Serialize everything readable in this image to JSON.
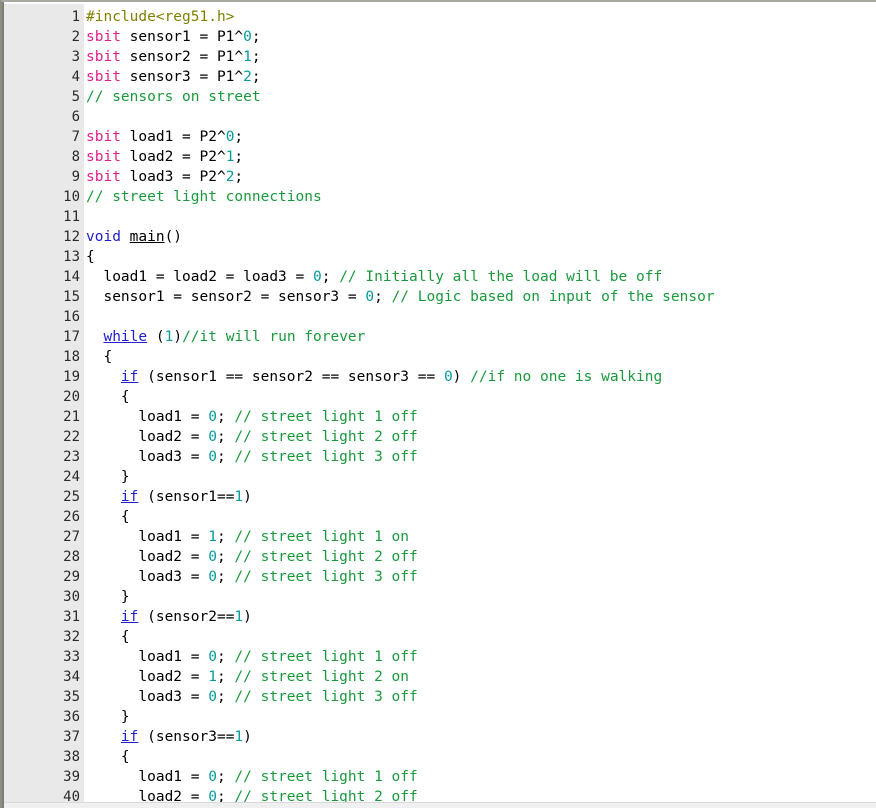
{
  "editor": {
    "name": "code-viewer",
    "language": "C (8051 / Keil)",
    "theme": {
      "background": "#ffffff",
      "gutter_background": "#e9e9e9",
      "gutter_text": "#2b2b2b",
      "plain_text": "#000000",
      "preprocessor": "#808000",
      "type_keyword": "#e0218a",
      "keyword": "#2020d0",
      "number": "#069a9a",
      "comment": "#199a3c",
      "border": "#8d8d84"
    },
    "first_line": 1,
    "last_line": 40,
    "total_visible_lines": 40
  },
  "code": {
    "lines": [
      {
        "n": "1",
        "tokens": [
          {
            "t": "preproc",
            "s": "#include<reg51.h>"
          }
        ]
      },
      {
        "n": "2",
        "tokens": [
          {
            "t": "type",
            "s": "sbit"
          },
          {
            "t": "plain",
            "s": " sensor1 = P1^"
          },
          {
            "t": "number",
            "s": "0"
          },
          {
            "t": "plain",
            "s": ";"
          }
        ]
      },
      {
        "n": "3",
        "tokens": [
          {
            "t": "type",
            "s": "sbit"
          },
          {
            "t": "plain",
            "s": " sensor2 = P1^"
          },
          {
            "t": "number",
            "s": "1"
          },
          {
            "t": "plain",
            "s": ";"
          }
        ]
      },
      {
        "n": "4",
        "tokens": [
          {
            "t": "type",
            "s": "sbit"
          },
          {
            "t": "plain",
            "s": " sensor3 = P1^"
          },
          {
            "t": "number",
            "s": "2"
          },
          {
            "t": "plain",
            "s": ";"
          }
        ]
      },
      {
        "n": "5",
        "tokens": [
          {
            "t": "comment",
            "s": "// sensors on street"
          }
        ]
      },
      {
        "n": "6",
        "tokens": [
          {
            "t": "plain",
            "s": ""
          }
        ]
      },
      {
        "n": "7",
        "tokens": [
          {
            "t": "type",
            "s": "sbit"
          },
          {
            "t": "plain",
            "s": " load1 = P2^"
          },
          {
            "t": "number",
            "s": "0"
          },
          {
            "t": "plain",
            "s": ";"
          }
        ]
      },
      {
        "n": "8",
        "tokens": [
          {
            "t": "type",
            "s": "sbit"
          },
          {
            "t": "plain",
            "s": " load2 = P2^"
          },
          {
            "t": "number",
            "s": "1"
          },
          {
            "t": "plain",
            "s": ";"
          }
        ]
      },
      {
        "n": "9",
        "tokens": [
          {
            "t": "type",
            "s": "sbit"
          },
          {
            "t": "plain",
            "s": " load3 = P2^"
          },
          {
            "t": "number",
            "s": "2"
          },
          {
            "t": "plain",
            "s": ";"
          }
        ]
      },
      {
        "n": "10",
        "tokens": [
          {
            "t": "comment",
            "s": "// street light connections"
          }
        ]
      },
      {
        "n": "11",
        "tokens": [
          {
            "t": "plain",
            "s": ""
          }
        ]
      },
      {
        "n": "12",
        "tokens": [
          {
            "t": "keyword-nu",
            "s": "void"
          },
          {
            "t": "plain",
            "s": " "
          },
          {
            "t": "ident-u",
            "s": "main"
          },
          {
            "t": "plain",
            "s": "()"
          }
        ]
      },
      {
        "n": "13",
        "tokens": [
          {
            "t": "plain",
            "s": "{"
          }
        ]
      },
      {
        "n": "14",
        "tokens": [
          {
            "t": "plain",
            "s": "  load1 = load2 = load3 = "
          },
          {
            "t": "number",
            "s": "0"
          },
          {
            "t": "plain",
            "s": "; "
          },
          {
            "t": "comment",
            "s": "// Initially all the load will be off"
          }
        ]
      },
      {
        "n": "15",
        "tokens": [
          {
            "t": "plain",
            "s": "  sensor1 = sensor2 = sensor3 = "
          },
          {
            "t": "number",
            "s": "0"
          },
          {
            "t": "plain",
            "s": "; "
          },
          {
            "t": "comment",
            "s": "// Logic based on input of the sensor"
          }
        ]
      },
      {
        "n": "16",
        "tokens": [
          {
            "t": "plain",
            "s": ""
          }
        ]
      },
      {
        "n": "17",
        "tokens": [
          {
            "t": "plain",
            "s": "  "
          },
          {
            "t": "keyword",
            "s": "while"
          },
          {
            "t": "plain",
            "s": " ("
          },
          {
            "t": "number",
            "s": "1"
          },
          {
            "t": "plain",
            "s": ")"
          },
          {
            "t": "comment",
            "s": "//it will run forever"
          }
        ]
      },
      {
        "n": "18",
        "tokens": [
          {
            "t": "plain",
            "s": "  {"
          }
        ]
      },
      {
        "n": "19",
        "tokens": [
          {
            "t": "plain",
            "s": "    "
          },
          {
            "t": "keyword",
            "s": "if"
          },
          {
            "t": "plain",
            "s": " (sensor1 == sensor2 == sensor3 == "
          },
          {
            "t": "number",
            "s": "0"
          },
          {
            "t": "plain",
            "s": ") "
          },
          {
            "t": "comment",
            "s": "//if no one is walking"
          }
        ]
      },
      {
        "n": "20",
        "tokens": [
          {
            "t": "plain",
            "s": "    {"
          }
        ]
      },
      {
        "n": "21",
        "tokens": [
          {
            "t": "plain",
            "s": "      load1 = "
          },
          {
            "t": "number",
            "s": "0"
          },
          {
            "t": "plain",
            "s": "; "
          },
          {
            "t": "comment",
            "s": "// street light 1 off"
          }
        ]
      },
      {
        "n": "22",
        "tokens": [
          {
            "t": "plain",
            "s": "      load2 = "
          },
          {
            "t": "number",
            "s": "0"
          },
          {
            "t": "plain",
            "s": "; "
          },
          {
            "t": "comment",
            "s": "// street light 2 off"
          }
        ]
      },
      {
        "n": "23",
        "tokens": [
          {
            "t": "plain",
            "s": "      load3 = "
          },
          {
            "t": "number",
            "s": "0"
          },
          {
            "t": "plain",
            "s": "; "
          },
          {
            "t": "comment",
            "s": "// street light 3 off"
          }
        ]
      },
      {
        "n": "24",
        "tokens": [
          {
            "t": "plain",
            "s": "    }"
          }
        ]
      },
      {
        "n": "25",
        "tokens": [
          {
            "t": "plain",
            "s": "    "
          },
          {
            "t": "keyword",
            "s": "if"
          },
          {
            "t": "plain",
            "s": " (sensor1=="
          },
          {
            "t": "number",
            "s": "1"
          },
          {
            "t": "plain",
            "s": ")"
          }
        ]
      },
      {
        "n": "26",
        "tokens": [
          {
            "t": "plain",
            "s": "    {"
          }
        ]
      },
      {
        "n": "27",
        "tokens": [
          {
            "t": "plain",
            "s": "      load1 = "
          },
          {
            "t": "number",
            "s": "1"
          },
          {
            "t": "plain",
            "s": "; "
          },
          {
            "t": "comment",
            "s": "// street light 1 on"
          }
        ]
      },
      {
        "n": "28",
        "tokens": [
          {
            "t": "plain",
            "s": "      load2 = "
          },
          {
            "t": "number",
            "s": "0"
          },
          {
            "t": "plain",
            "s": "; "
          },
          {
            "t": "comment",
            "s": "// street light 2 off"
          }
        ]
      },
      {
        "n": "29",
        "tokens": [
          {
            "t": "plain",
            "s": "      load3 = "
          },
          {
            "t": "number",
            "s": "0"
          },
          {
            "t": "plain",
            "s": "; "
          },
          {
            "t": "comment",
            "s": "// street light 3 off"
          }
        ]
      },
      {
        "n": "30",
        "tokens": [
          {
            "t": "plain",
            "s": "    }"
          }
        ]
      },
      {
        "n": "31",
        "tokens": [
          {
            "t": "plain",
            "s": "    "
          },
          {
            "t": "keyword",
            "s": "if"
          },
          {
            "t": "plain",
            "s": " (sensor2=="
          },
          {
            "t": "number",
            "s": "1"
          },
          {
            "t": "plain",
            "s": ")"
          }
        ]
      },
      {
        "n": "32",
        "tokens": [
          {
            "t": "plain",
            "s": "    {"
          }
        ]
      },
      {
        "n": "33",
        "tokens": [
          {
            "t": "plain",
            "s": "      load1 = "
          },
          {
            "t": "number",
            "s": "0"
          },
          {
            "t": "plain",
            "s": "; "
          },
          {
            "t": "comment",
            "s": "// street light 1 off"
          }
        ]
      },
      {
        "n": "34",
        "tokens": [
          {
            "t": "plain",
            "s": "      load2 = "
          },
          {
            "t": "number",
            "s": "1"
          },
          {
            "t": "plain",
            "s": "; "
          },
          {
            "t": "comment",
            "s": "// street light 2 on"
          }
        ]
      },
      {
        "n": "35",
        "tokens": [
          {
            "t": "plain",
            "s": "      load3 = "
          },
          {
            "t": "number",
            "s": "0"
          },
          {
            "t": "plain",
            "s": "; "
          },
          {
            "t": "comment",
            "s": "// street light 3 off"
          }
        ]
      },
      {
        "n": "36",
        "tokens": [
          {
            "t": "plain",
            "s": "    }"
          }
        ]
      },
      {
        "n": "37",
        "tokens": [
          {
            "t": "plain",
            "s": "    "
          },
          {
            "t": "keyword",
            "s": "if"
          },
          {
            "t": "plain",
            "s": " (sensor3=="
          },
          {
            "t": "number",
            "s": "1"
          },
          {
            "t": "plain",
            "s": ")"
          }
        ]
      },
      {
        "n": "38",
        "tokens": [
          {
            "t": "plain",
            "s": "    {"
          }
        ]
      },
      {
        "n": "39",
        "tokens": [
          {
            "t": "plain",
            "s": "      load1 = "
          },
          {
            "t": "number",
            "s": "0"
          },
          {
            "t": "plain",
            "s": "; "
          },
          {
            "t": "comment",
            "s": "// street light 1 off"
          }
        ]
      },
      {
        "n": "40",
        "tokens": [
          {
            "t": "plain",
            "s": "      load2 = "
          },
          {
            "t": "number",
            "s": "0"
          },
          {
            "t": "plain",
            "s": "; "
          },
          {
            "t": "comment",
            "s": "// street light 2 off"
          }
        ]
      }
    ]
  }
}
